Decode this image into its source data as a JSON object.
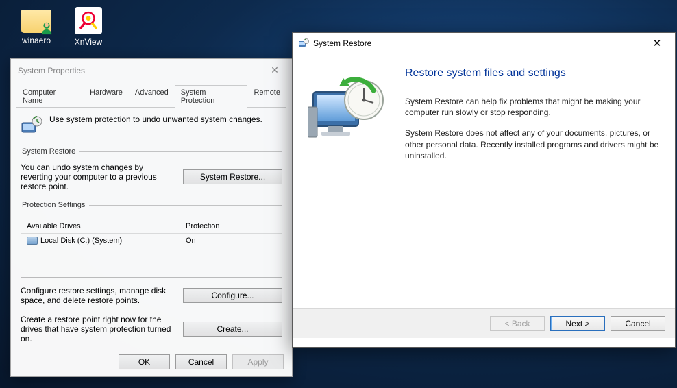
{
  "desktop": {
    "icons": [
      {
        "label": "winaero"
      },
      {
        "label": "XnView"
      }
    ]
  },
  "sysprops": {
    "title": "System Properties",
    "tabs": [
      "Computer Name",
      "Hardware",
      "Advanced",
      "System Protection",
      "Remote"
    ],
    "active_tab_index": 3,
    "intro": "Use system protection to undo unwanted system changes.",
    "group_restore": {
      "legend": "System Restore",
      "text": "You can undo system changes by reverting your computer to a previous restore point.",
      "button": "System Restore..."
    },
    "group_protection": {
      "legend": "Protection Settings",
      "col_drive": "Available Drives",
      "col_prot": "Protection",
      "rows": [
        {
          "drive": "Local Disk (C:) (System)",
          "protection": "On"
        }
      ],
      "configure_text": "Configure restore settings, manage disk space, and delete restore points.",
      "configure_btn": "Configure...",
      "create_text": "Create a restore point right now for the drives that have system protection turned on.",
      "create_btn": "Create..."
    },
    "buttons": {
      "ok": "OK",
      "cancel": "Cancel",
      "apply": "Apply"
    }
  },
  "restore": {
    "title": "System Restore",
    "heading": "Restore system files and settings",
    "para1": "System Restore can help fix problems that might be making your computer run slowly or stop responding.",
    "para2": "System Restore does not affect any of your documents, pictures, or other personal data. Recently installed programs and drivers might be uninstalled.",
    "buttons": {
      "back": "< Back",
      "next": "Next >",
      "cancel": "Cancel"
    }
  }
}
